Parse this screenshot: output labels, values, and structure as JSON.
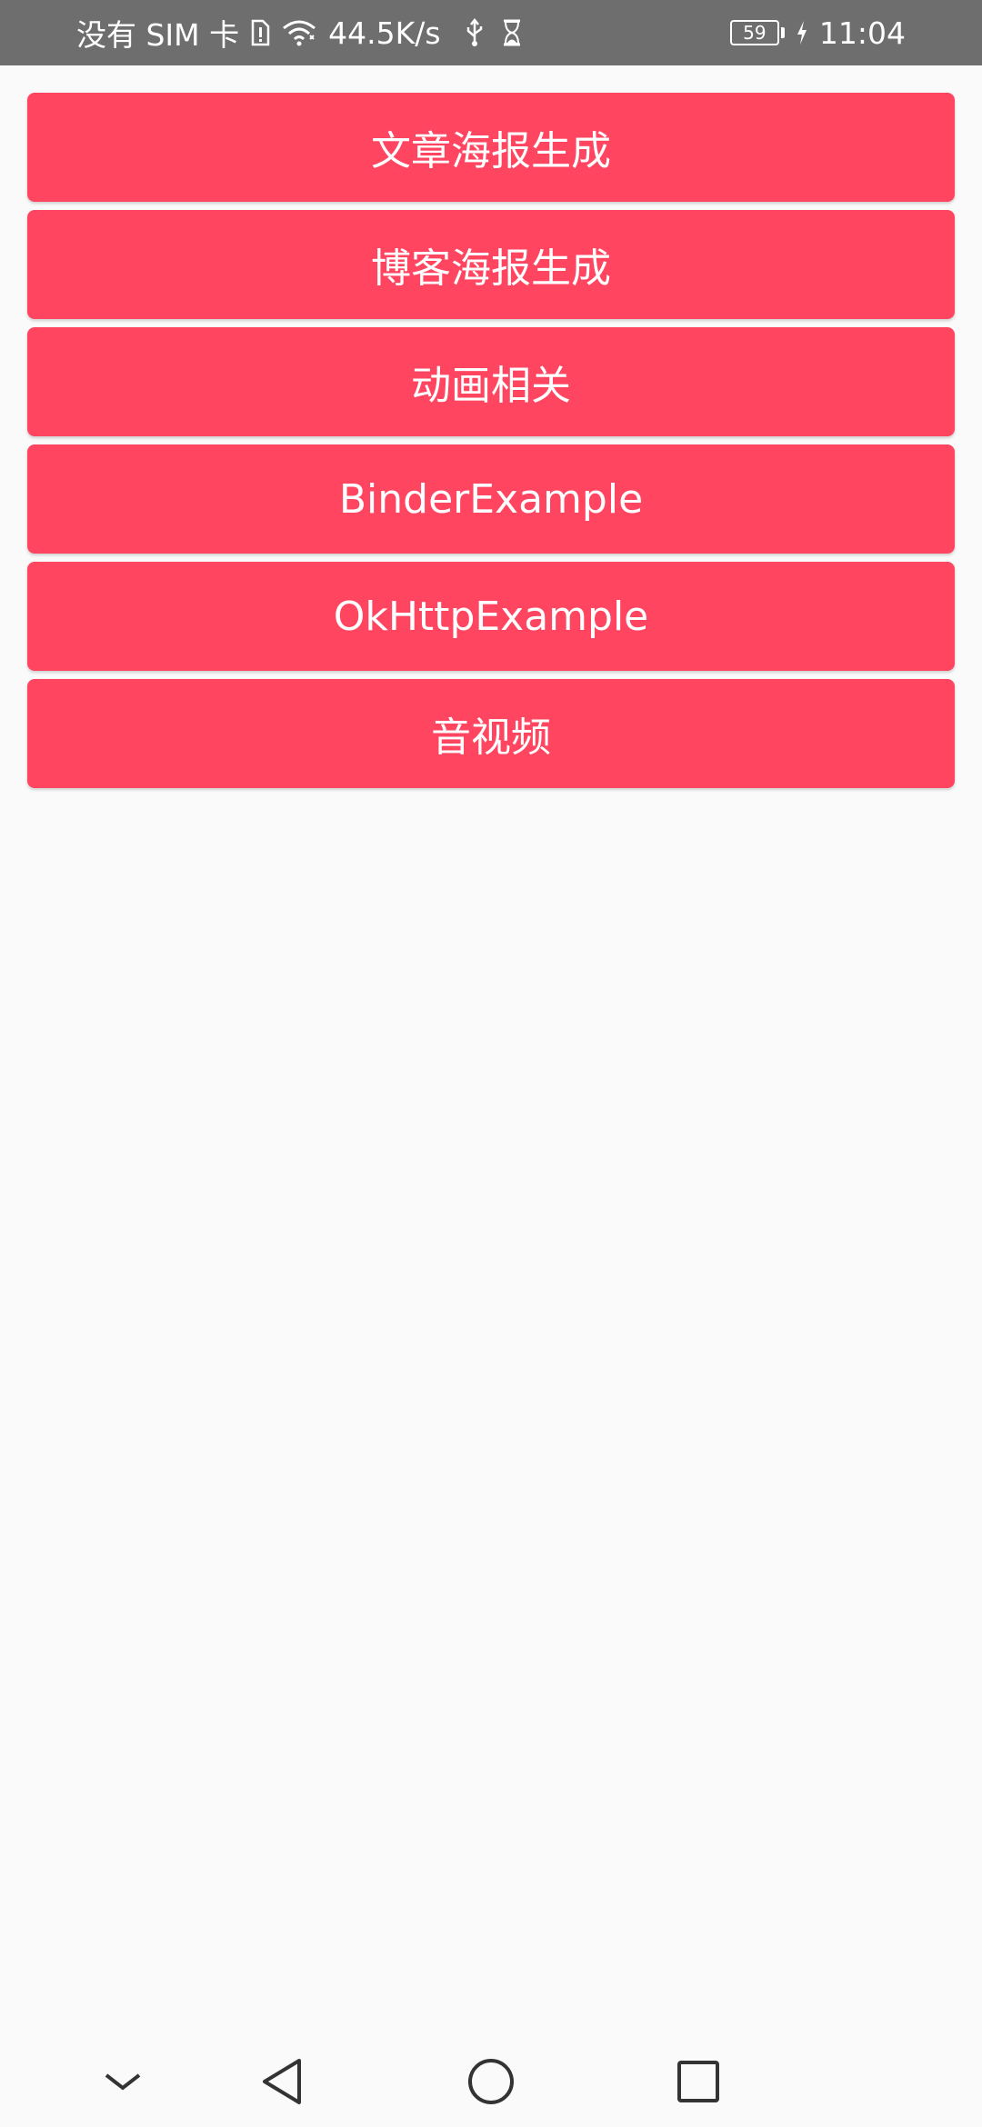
{
  "status_bar": {
    "carrier": "没有 SIM 卡",
    "speed": "44.5K/s",
    "battery_level": "59",
    "time": "11:04",
    "icons": [
      "sim-alert-icon",
      "wifi-icon",
      "usb-icon",
      "hourglass-icon",
      "charging-icon"
    ]
  },
  "buttons": [
    {
      "label": "文章海报生成"
    },
    {
      "label": "博客海报生成"
    },
    {
      "label": "动画相关"
    },
    {
      "label": "BinderExample"
    },
    {
      "label": "OkHttpExample"
    },
    {
      "label": "音视频"
    }
  ],
  "colors": {
    "accent": "#ff4560",
    "status_bar": "#6e6e6e",
    "background": "#fafafa"
  },
  "nav_bar": {
    "icons": [
      "chevron-down-icon",
      "back-icon",
      "home-icon",
      "recents-icon"
    ]
  }
}
